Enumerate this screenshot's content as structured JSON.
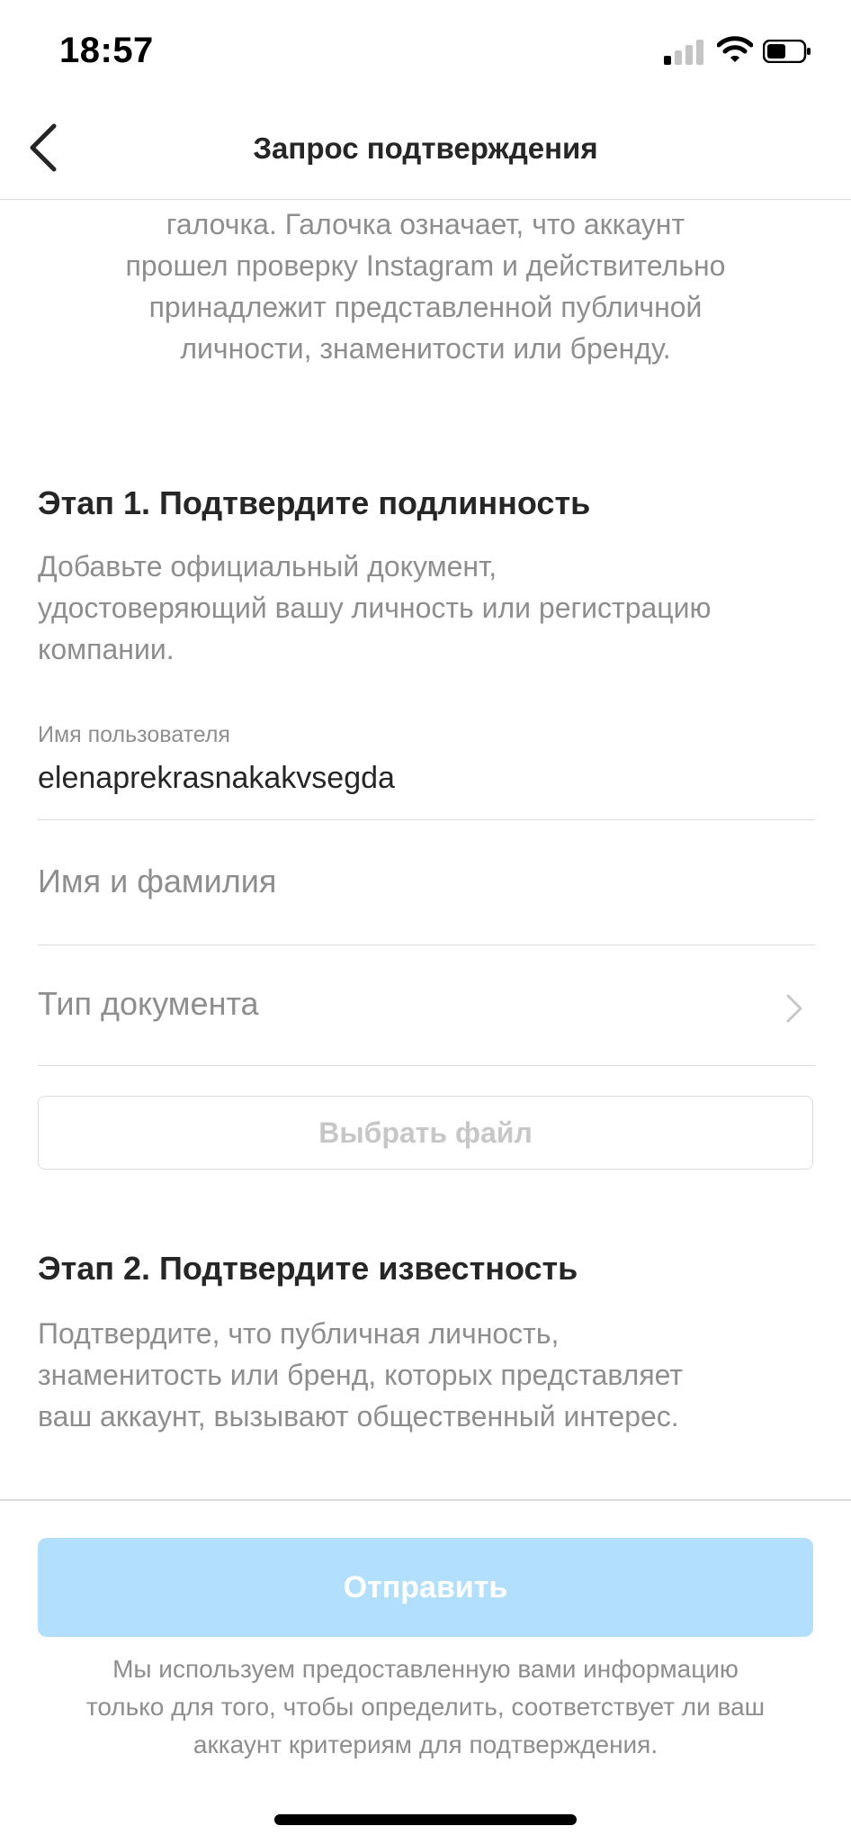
{
  "status_bar": {
    "time": "18:57"
  },
  "nav": {
    "title": "Запрос подтверждения"
  },
  "intro": {
    "lines": [
      "галочка. Галочка означает, что аккаунт",
      "прошел проверку Instagram и действительно",
      "принадлежит представленной публичной",
      "личности, знаменитости или бренду."
    ]
  },
  "step1": {
    "title": "Этап 1. Подтвердите подлинность",
    "lines": [
      "Добавьте официальный документ,",
      "удостоверяющий вашу личность или регистрацию",
      "компании."
    ]
  },
  "form": {
    "username_label": "Имя пользователя",
    "username_value": "elenaprekrasnakakvsegda",
    "fullname_placeholder": "Имя и фамилия",
    "doctype_placeholder": "Тип документа",
    "file_button": "Выбрать файл"
  },
  "step2": {
    "title": "Этап 2. Подтвердите известность",
    "lines": [
      "Подтвердите, что публичная личность,",
      "знаменитость или бренд, которых представляет",
      "ваш аккаунт, вызывают общественный интерес."
    ]
  },
  "submit": {
    "label": "Отправить"
  },
  "footer": {
    "lines": [
      "Мы используем предоставленную вами информацию",
      "только для того, чтобы определить, соответствует ли ваш",
      "аккаунт критериям для подтверждения."
    ]
  },
  "colors": {
    "primary_disabled": "#b2dffc",
    "secondary_text": "#8e8e8e",
    "divider": "#dbdbdb"
  },
  "icons": [
    "back-chevron-icon",
    "chevron-right-icon",
    "signal-icon",
    "wifi-icon",
    "battery-icon"
  ]
}
